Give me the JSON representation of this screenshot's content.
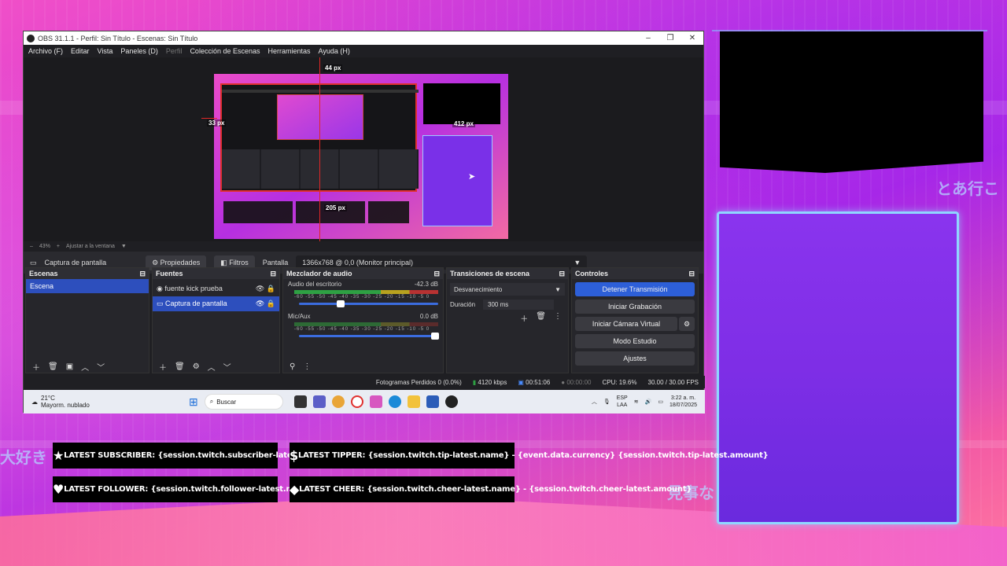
{
  "window": {
    "title": "OBS 31.1.1 - Perfil: Sin Título - Escenas: Sin Título",
    "controls": [
      "–",
      "❐",
      "✕"
    ]
  },
  "menu": [
    "Archivo (F)",
    "Editar",
    "Vista",
    "Paneles (D)",
    "Perfil",
    "Colección de Escenas",
    "Herramientas",
    "Ayuda (H)"
  ],
  "preview": {
    "label_top": "44 px",
    "label_left": "33 px",
    "label_right": "412 px",
    "label_bottom": "205 px"
  },
  "zoom": {
    "minus": "–",
    "value": "43%",
    "plus": "+",
    "fit": "Ajustar a la ventana"
  },
  "source_bar": {
    "source_name": "Captura de pantalla",
    "properties": "Propiedades",
    "filters": "Filtros",
    "screen_label": "Pantalla",
    "screen_value": "1366x768 @ 0,0 (Monitor principal)"
  },
  "docks": {
    "scenes": {
      "title": "Escenas",
      "items": [
        "Escena"
      ]
    },
    "sources": {
      "title": "Fuentes",
      "items": [
        "fuente kick prueba",
        "Captura de pantalla"
      ]
    },
    "mixer": {
      "title": "Mezclador de audio",
      "channels": [
        {
          "name": "Audio del escritorio",
          "db": "-42.3 dB",
          "level": 0.7
        },
        {
          "name": "Mic/Aux",
          "db": "0.0 dB",
          "level": 0.1
        }
      ],
      "scale": "-60 -55 -50 -45 -40 -35 -30 -25 -20 -15 -10 -5 0"
    },
    "transitions": {
      "title": "Transiciones de escena",
      "selected": "Desvanecimiento",
      "duration_label": "Duración",
      "duration_value": "300 ms"
    },
    "controls": {
      "title": "Controles",
      "buttons": [
        "Detener Transmisión",
        "Iniciar Grabación",
        "Iniciar Cámara Virtual",
        "Modo Estudio",
        "Ajustes"
      ]
    }
  },
  "status": {
    "dropped": "Fotogramas Perdidos 0 (0.0%)",
    "bitrate": "4120 kbps",
    "stream_time": "00:51:06",
    "rec_time": "00:00:00",
    "cpu": "CPU: 19.6%",
    "fps": "30.00 / 30.00 FPS"
  },
  "taskbar": {
    "temp": "21°C",
    "weather": "Mayorm. nublado",
    "search_placeholder": "Buscar",
    "lang1": "ESP",
    "lang2": "LAA",
    "time": "3:22 a. m.",
    "date": "18/07/2025"
  },
  "alerts": [
    {
      "icon": "★",
      "text": "LATEST SUBSCRIBER: {session.twitch.subscriber-latest.name}"
    },
    {
      "icon": "$",
      "text": "LATEST TIPPER: {session.twitch.tip-latest.name} - {event.data.currency} {session.twitch.tip-latest.amount}"
    },
    {
      "icon": "♥",
      "text": "LATEST FOLLOWER: {session.twitch.follower-latest.name}"
    },
    {
      "icon": "◆",
      "text": "LATEST CHEER: {session.twitch.cheer-latest.name} - {session.twitch.cheer-latest.amount}"
    }
  ],
  "deco": {
    "jp1": "大好き",
    "jp2": "見事な",
    "jp3": "とあ行こ"
  },
  "colors": {
    "accent": "#2d5fd8",
    "record_red": "#e02727",
    "frame_blue": "#8fd6ff"
  }
}
